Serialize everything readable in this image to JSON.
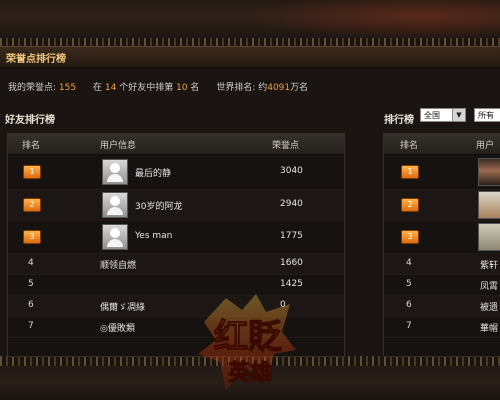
{
  "title": "荣誉点排行榜",
  "stats": {
    "honor_label": "我的荣誉点:",
    "honor_value": "155",
    "rank_prefix": "在",
    "friends_count": "14",
    "rank_middle": "个好友中排第",
    "friend_rank": "10",
    "rank_suffix": "名",
    "world_label": "世界排名: 约",
    "world_value": "4091",
    "world_suffix": "万名"
  },
  "friends": {
    "label": "好友排行榜",
    "headers": {
      "rank": "排名",
      "user": "用户信息",
      "points": "荣誉点"
    },
    "rows": [
      {
        "rank": "1",
        "name": "最后的静",
        "points": "3040",
        "badge": true,
        "avatar": true
      },
      {
        "rank": "2",
        "name": "30岁的阿龙",
        "points": "2940",
        "badge": true,
        "avatar": true
      },
      {
        "rank": "3",
        "name": "Yes man",
        "points": "1775",
        "badge": true,
        "avatar": true
      },
      {
        "rank": "4",
        "name": "顺领自燃",
        "points": "1660",
        "badge": false,
        "avatar": false
      },
      {
        "rank": "5",
        "name": "",
        "points": "1425",
        "badge": false,
        "avatar": false
      },
      {
        "rank": "6",
        "name": "偶爾ゞ凋綠",
        "points": "0",
        "badge": false,
        "avatar": false
      },
      {
        "rank": "7",
        "name": "◎優敗類",
        "points": "",
        "badge": false,
        "avatar": false
      }
    ]
  },
  "world": {
    "label": "排行榜",
    "region_select": "全国",
    "scope_select": "所有",
    "headers": {
      "rank": "排名",
      "user": "用户"
    },
    "rows": [
      {
        "rank": "1",
        "name": ""
      },
      {
        "rank": "2",
        "name": ""
      },
      {
        "rank": "3",
        "name": ""
      },
      {
        "rank": "4",
        "name": "紫轩"
      },
      {
        "rank": "5",
        "name": "凤霄"
      },
      {
        "rank": "6",
        "name": "被遗"
      },
      {
        "rank": "7",
        "name": "華帽"
      }
    ]
  },
  "logo_text": {
    "line1": "红貶",
    "line2": "英雄"
  },
  "colors": {
    "accent": "#f2a23a",
    "title": "#f0c77a",
    "badge": "#f08a1e"
  }
}
